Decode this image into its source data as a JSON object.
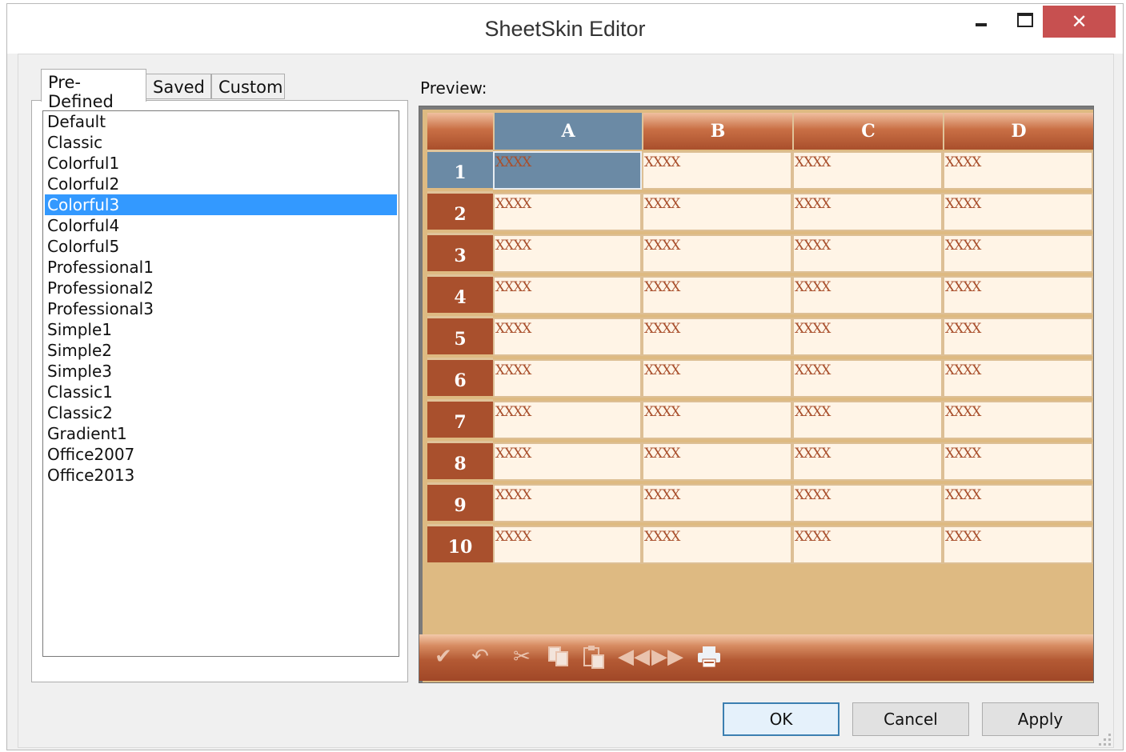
{
  "window": {
    "title": "SheetSkin Editor",
    "minimize_glyph": "",
    "close_glyph": "✕"
  },
  "tabs": [
    {
      "label": "Pre-Defined",
      "active": true
    },
    {
      "label": "Saved",
      "active": false
    },
    {
      "label": "Custom",
      "active": false
    }
  ],
  "skins": {
    "selected": "Colorful3",
    "items": [
      "Default",
      "Classic",
      "Colorful1",
      "Colorful2",
      "Colorful3",
      "Colorful4",
      "Colorful5",
      "Professional1",
      "Professional2",
      "Professional3",
      "Simple1",
      "Simple2",
      "Simple3",
      "Classic1",
      "Classic2",
      "Gradient1",
      "Office2007",
      "Office2013"
    ]
  },
  "preview": {
    "label": "Preview:",
    "columns": [
      "A",
      "B",
      "C",
      "D"
    ],
    "rows": [
      "1",
      "2",
      "3",
      "4",
      "5",
      "6",
      "7",
      "8",
      "9",
      "10"
    ],
    "cell_text": "XXXX",
    "selected_cell": {
      "row": "1",
      "column": "A"
    },
    "toolbar_icons": [
      "check-icon",
      "undo-icon",
      "cut-icon",
      "copy-icon",
      "paste-icon",
      "previous-icon",
      "next-icon",
      "print-icon"
    ],
    "colors": {
      "header_brown": "#a9502d",
      "cell_bg": "#fff4e6",
      "selection_blue": "#6b8aa5",
      "empty_area": "#deba82"
    }
  },
  "buttons": {
    "ok": "OK",
    "cancel": "Cancel",
    "apply": "Apply"
  }
}
